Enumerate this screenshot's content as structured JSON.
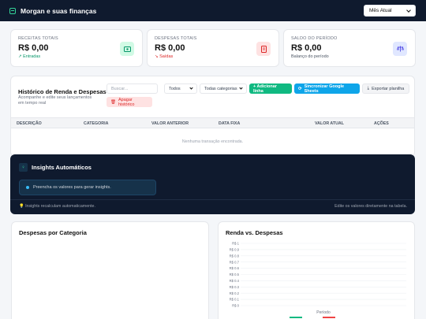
{
  "header": {
    "title": "Morgan e suas finanças",
    "period_select": "Mês Atual"
  },
  "stats": [
    {
      "label": "RECEITAS TOTAIS",
      "value": "R$ 0,00",
      "sub": "↗ Entradas",
      "icon": "receipt-icon",
      "sub_color": "#059669",
      "icon_bg": "#d1fae5",
      "icon_color": "#059669"
    },
    {
      "label": "DESPESAS TOTAIS",
      "value": "R$ 0,00",
      "sub": "↘ Saídas",
      "icon": "receipt-icon",
      "sub_color": "#dc2626",
      "icon_bg": "#fee2e2",
      "icon_color": "#dc2626"
    },
    {
      "label": "SALDO DO PERÍODO",
      "value": "R$ 0,00",
      "sub": "Balanço do período",
      "icon": "scale-icon",
      "sub_color": "#4b5563",
      "icon_bg": "#e0e7ff",
      "icon_color": "#4f46e5"
    }
  ],
  "history": {
    "title": "Histórico de Renda e Despesas",
    "description": "Acompanhe e edite seus lançamentos em tempo real",
    "search_placeholder": "Buscar...",
    "filter_type": "Todos",
    "filter_category": "Todas categorias",
    "add_button": "+ Adicionar linha",
    "sync_button": "Sincronizar Google Sheets",
    "export_button": "Exportar planilha",
    "clear_button": "Apagar histórico",
    "columns": [
      "DESCRIÇÃO",
      "CATEGORIA",
      "VALOR ANTERIOR",
      "DATA FIXA",
      "VALOR ATUAL",
      "AÇÕES"
    ],
    "empty_text": "Nenhuma transação encontrada."
  },
  "insights": {
    "title": "Insights Automáticos",
    "message": "Preencha os valores para gerar insights.",
    "footer_left": "💡 Insights recalculam automaticamente.",
    "footer_right": "Edite os valores diretamente na tabela."
  },
  "charts": {
    "category_title": "Despesas por Categoria",
    "income_title": "Renda vs. Despesas"
  },
  "chart_data": {
    "type": "bar",
    "title": "Renda vs. Despesas",
    "xlabel": "Período",
    "ylabel": "",
    "categories": [],
    "yticks": [
      "R$ 1",
      "R$ 0.9",
      "R$ 0.8",
      "R$ 0.7",
      "R$ 0.6",
      "R$ 0.5",
      "R$ 0.4",
      "R$ 0.3",
      "R$ 0.2",
      "R$ 0.1",
      "R$ 0"
    ],
    "ylim": [
      0,
      1
    ],
    "grid": true,
    "series_colors": [
      "#10b981",
      "#ef4444"
    ],
    "series": []
  },
  "colors": {
    "accent_green": "#10b981",
    "accent_blue": "#0ea5e9",
    "danger": "#dc2626",
    "dark": "#0f1a2e"
  }
}
